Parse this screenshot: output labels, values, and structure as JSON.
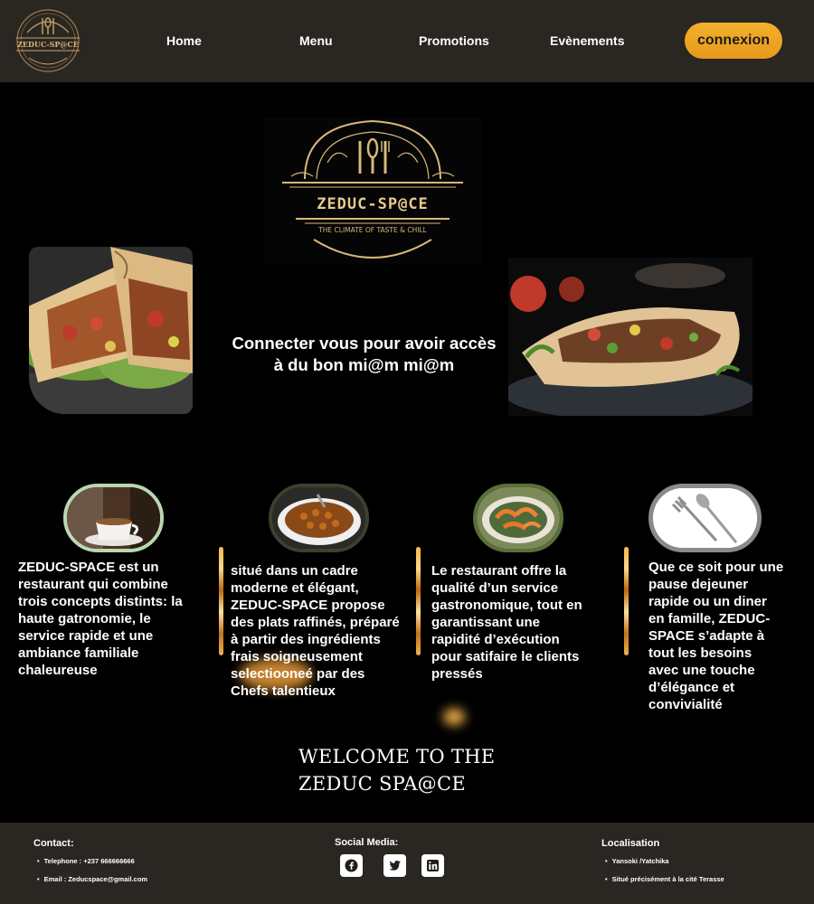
{
  "header": {
    "logo_text": "ZEDUC-SP@CE",
    "nav": [
      "Home",
      "Menu",
      "Promotions",
      "Evènements"
    ],
    "connexion_label": "connexion"
  },
  "hero": {
    "logo_title": "ZEDUC-SP@CE",
    "logo_tagline": "THE CLIMATE OF TASTE & CHILL",
    "line1": "Connecter vous pour avoir accès",
    "line2": "à du bon mi@m mi@m"
  },
  "features": [
    {
      "icon": "coffee-cup-image",
      "text": "ZEDUC-SPACE est un restaurant  qui combine trois concepts distints: la haute gatronomie,  le service rapide et une ambiance familiale chaleureuse"
    },
    {
      "icon": "plated-dish-image",
      "text": "situé dans un cadre moderne et élégant, ZEDUC-SPACE propose des plats raffinés, préparé à partir des ingrédients frais soigneusement selectiooneé par des Chefs talentieux"
    },
    {
      "icon": "shrimp-plate-image",
      "text": "Le restaurant offre la qualité d’un service gastronomique, tout en garantissant une rapidité d’exécution pour satifaire le clients pressés"
    },
    {
      "icon": "cutlery-image",
      "text": "Que ce soit pour une pause dejeuner rapide ou un diner en famille, ZEDUC-SPACE s’adapte à tout les besoins avec une touche d’élégance et convivialité"
    }
  ],
  "welcome": {
    "line1": "WELCOME TO THE",
    "line2": "ZEDUC SPA@CE"
  },
  "footer": {
    "contact_title": "Contact:",
    "contact_phone": "Telephone : +237 666666666",
    "contact_email": "Email : Zeducspace@gmail.com",
    "social_title": "Social Media:",
    "social_icons": [
      "facebook-icon",
      "twitter-icon",
      "linkedin-icon"
    ],
    "location_title": "Localisation",
    "location_1": "Yansoki /Yatchika",
    "location_2": "Situé précisément à la cité Terasse"
  },
  "colors": {
    "header_bg": "#2a2622",
    "accent": "#f0a623",
    "gold": "#d9b77a",
    "page_bg": "#000000"
  }
}
